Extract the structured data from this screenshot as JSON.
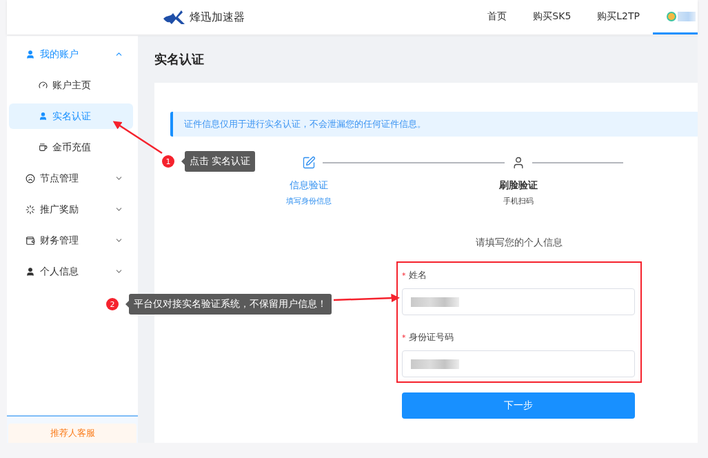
{
  "header": {
    "brand": "烽迅加速器",
    "nav": [
      {
        "kind": "link",
        "label": "首页",
        "selected": false
      },
      {
        "kind": "link",
        "label": "购买SK5",
        "selected": false
      },
      {
        "kind": "link",
        "label": "购买L2TP",
        "selected": false
      },
      {
        "kind": "user",
        "selected": true
      }
    ]
  },
  "sidebar": {
    "items": [
      {
        "label": "我的账户",
        "expanded": true,
        "selected": false,
        "children": [
          {
            "label": "账户主页",
            "selected": false
          },
          {
            "label": "实名认证",
            "selected": true
          },
          {
            "label": "金币充值",
            "selected": false
          }
        ]
      },
      {
        "label": "节点管理",
        "expanded": false,
        "selected": false
      },
      {
        "label": "推广奖励",
        "expanded": false,
        "selected": false
      },
      {
        "label": "财务管理",
        "expanded": false,
        "selected": false
      },
      {
        "label": "个人信息",
        "expanded": false,
        "selected": false
      }
    ],
    "footer": "推荐人客服"
  },
  "page_title": "实名认证",
  "notice": "证件信息仅用于进行实名认证，不会泄漏您的任何证件信息。",
  "steps": [
    {
      "title": "信息验证",
      "subtitle": "填写身份信息",
      "selected": true
    },
    {
      "title": "刷脸验证",
      "subtitle": "手机扫码",
      "selected": false
    }
  ],
  "form": {
    "heading": "请填写您的个人信息",
    "fields": [
      {
        "mark": "*",
        "label": "姓名",
        "blurred": true
      },
      {
        "mark": "*",
        "label": "身份证号码",
        "blurred": true
      }
    ],
    "submit": "下一步"
  },
  "annotations": [
    {
      "number": "1",
      "text": "点击 实名认证"
    },
    {
      "number": "2",
      "text": "平台仅对接实名验证系统，不保留用户信息！"
    }
  ]
}
